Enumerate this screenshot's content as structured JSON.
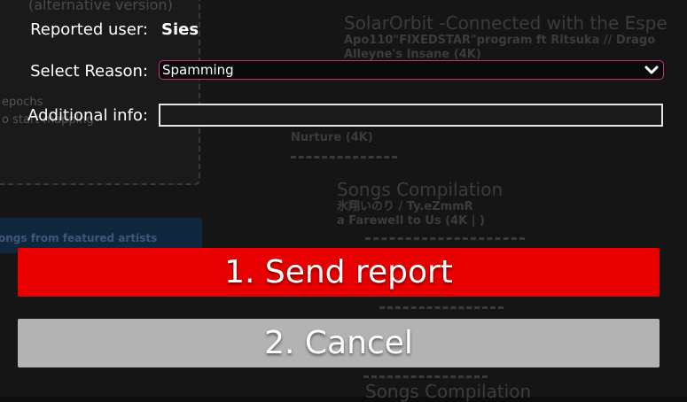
{
  "background": {
    "left_panel_title": "(alternative version)",
    "left_panel_lines": [
      "epochs",
      "o start mapping"
    ],
    "featured_bar": "ongs from featured artists",
    "entries": [
      {
        "title": "SolarOrbit -Connected with the Espe",
        "sub1": "Apo110\"FIXEDSTAR\"program ft Ritsuka // Drago",
        "sub2": "Alleyne's Insane (4K)"
      },
      {
        "title": "",
        "sub1": "Nurture (4K)",
        "sub2": ""
      },
      {
        "title": "Songs Compilation",
        "sub1": "氷翔いのり / Ty.eZmmR",
        "sub2": "a Farewell to Us (4K | )"
      },
      {
        "title": "Songs Compilation",
        "sub1": "",
        "sub2": ""
      }
    ]
  },
  "dialog": {
    "reported_user_label": "Reported user:",
    "reported_user_value": "Sies",
    "reason_label": "Select Reason:",
    "reason_selected": "Spamming",
    "additional_label": "Additional info:",
    "additional_value": "",
    "send_button": "1. Send report",
    "cancel_button": "2. Cancel"
  },
  "colors": {
    "send": "#e80000",
    "cancel": "#b3b3b3",
    "select_border": "#c0327a"
  }
}
